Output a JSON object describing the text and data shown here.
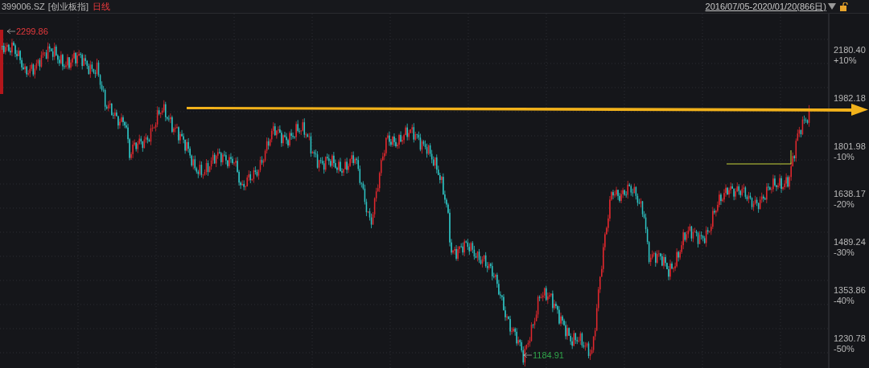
{
  "header": {
    "code": "399006.SZ",
    "name": "[创业板指]",
    "period": "日线",
    "range": "2016/07/05-2020/01/20(866日)"
  },
  "y_axis": [
    {
      "price": "2180.40",
      "change": "+10%"
    },
    {
      "price": "1982.18"
    },
    {
      "price": "1801.98",
      "change": "-10%"
    },
    {
      "price": "1638.17",
      "change": "-20%"
    },
    {
      "price": "1489.24",
      "change": "-30%"
    },
    {
      "price": "1353.86",
      "change": "-40%"
    },
    {
      "price": "1230.78",
      "change": "-50%"
    }
  ],
  "annotations": {
    "high": "2299.86",
    "low": "1184.91"
  }
}
